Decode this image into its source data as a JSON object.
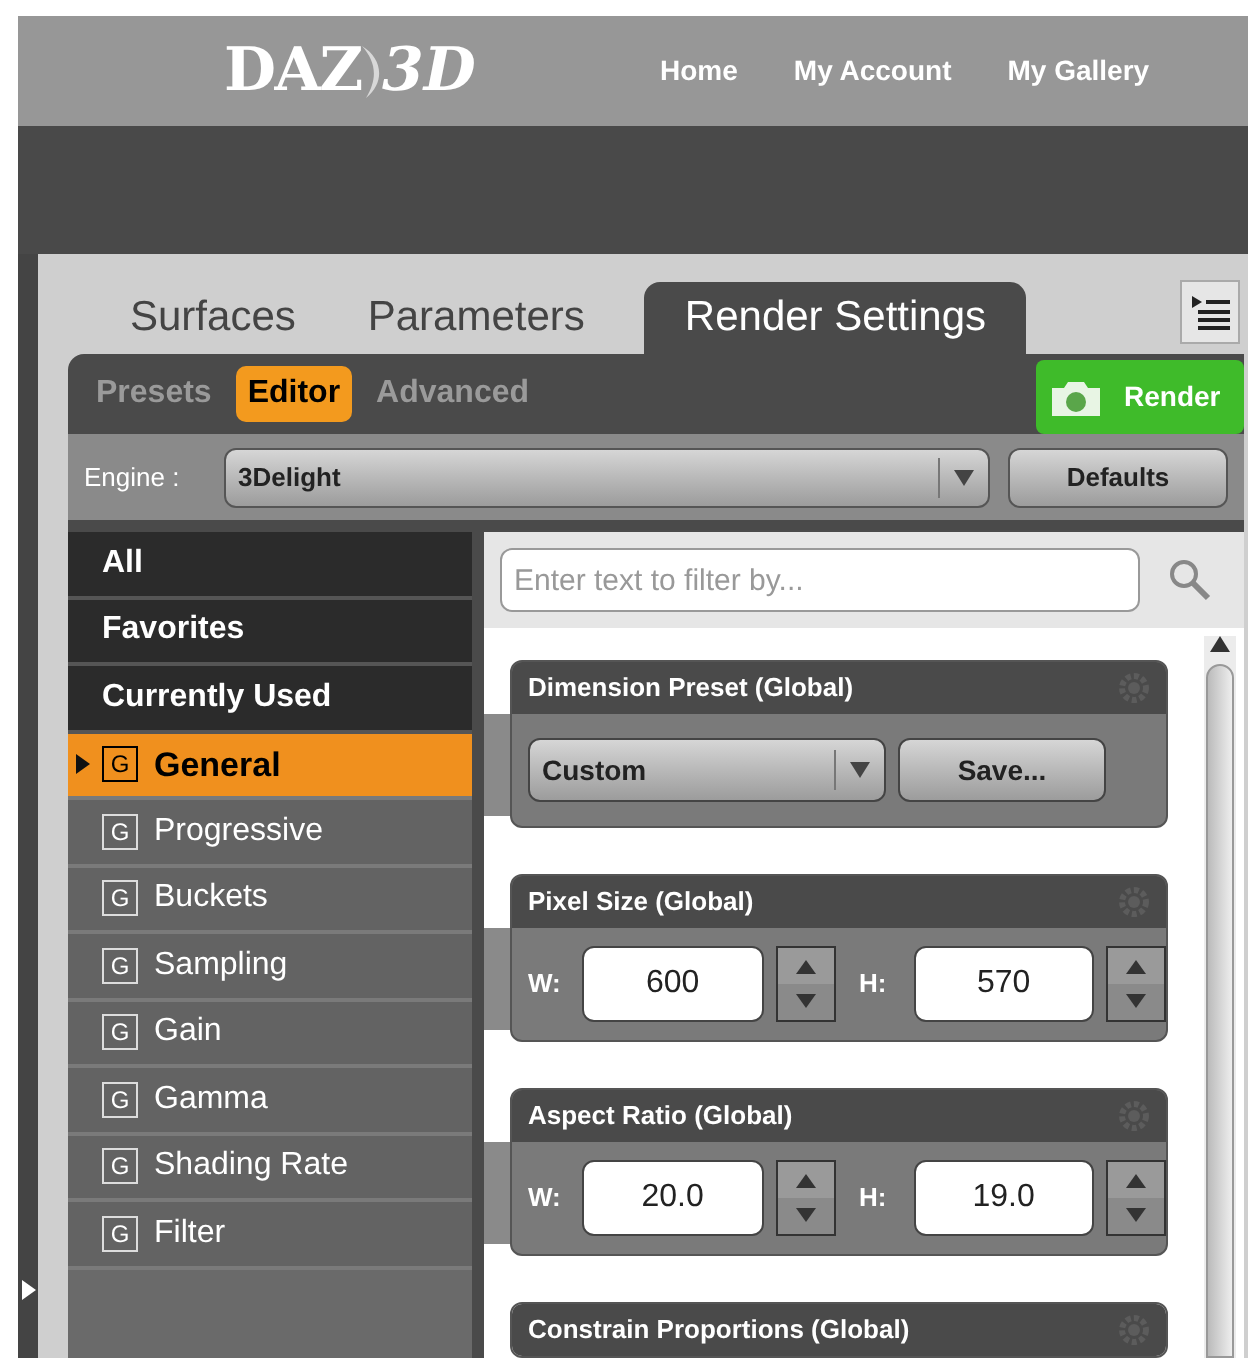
{
  "header": {
    "logo": [
      "DAZ",
      "3D"
    ],
    "nav": [
      "Home",
      "My Account",
      "My Gallery"
    ]
  },
  "tabs": [
    {
      "label": "Surfaces",
      "selected": false
    },
    {
      "label": "Parameters",
      "selected": false
    },
    {
      "label": "Render Settings",
      "selected": true
    }
  ],
  "subtabs": [
    {
      "label": "Presets",
      "selected": false
    },
    {
      "label": "Editor",
      "selected": true
    },
    {
      "label": "Advanced",
      "selected": false
    }
  ],
  "render_button": "Render",
  "engine": {
    "label": "Engine :",
    "value": "3Delight"
  },
  "defaults_button": "Defaults",
  "categories": [
    {
      "label": "All",
      "kind": "group",
      "selected": false
    },
    {
      "label": "Favorites",
      "kind": "group",
      "selected": false
    },
    {
      "label": "Currently Used",
      "kind": "group",
      "selected": false
    },
    {
      "label": "General",
      "kind": "section",
      "badge": "G",
      "selected": true
    },
    {
      "label": "Progressive",
      "kind": "section",
      "badge": "G",
      "selected": false
    },
    {
      "label": "Buckets",
      "kind": "section",
      "badge": "G",
      "selected": false
    },
    {
      "label": "Sampling",
      "kind": "section",
      "badge": "G",
      "selected": false
    },
    {
      "label": "Gain",
      "kind": "section",
      "badge": "G",
      "selected": false
    },
    {
      "label": "Gamma",
      "kind": "section",
      "badge": "G",
      "selected": false
    },
    {
      "label": "Shading Rate",
      "kind": "section",
      "badge": "G",
      "selected": false
    },
    {
      "label": "Filter",
      "kind": "section",
      "badge": "G",
      "selected": false
    }
  ],
  "filter": {
    "placeholder": "Enter text to filter by..."
  },
  "properties": [
    {
      "title": "Dimension Preset (Global)",
      "kind": "preset",
      "value": "Custom",
      "button": "Save..."
    },
    {
      "title": "Pixel Size (Global)",
      "kind": "pair",
      "fields": [
        {
          "label": "W:",
          "value": "600"
        },
        {
          "label": "H:",
          "value": "570"
        }
      ]
    },
    {
      "title": "Aspect Ratio (Global)",
      "kind": "pair",
      "fields": [
        {
          "label": "W:",
          "value": "20.0"
        },
        {
          "label": "H:",
          "value": "19.0"
        }
      ]
    },
    {
      "title": "Constrain Proportions (Global)",
      "kind": "header"
    }
  ]
}
